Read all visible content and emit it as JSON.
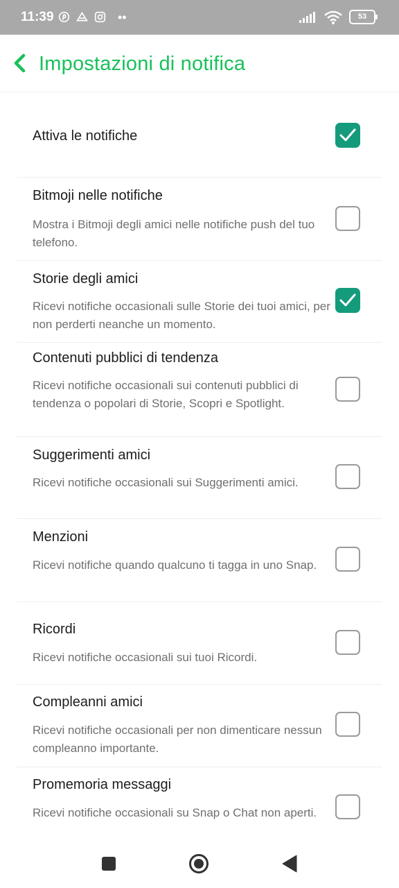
{
  "status_bar": {
    "time": "11:39",
    "battery": "53",
    "icons": [
      "pinterest-icon",
      "drive-icon",
      "instagram-icon",
      "more-dots-icon",
      "signal-icon",
      "wifi-icon",
      "battery-icon"
    ]
  },
  "header": {
    "title": "Impostazioni di notifica",
    "back_icon": "chevron-left-icon",
    "accent_color": "#19c05a"
  },
  "settings": [
    {
      "title": "Attiva le notifiche",
      "description": "",
      "checked": true
    },
    {
      "title": "Bitmoji nelle notifiche",
      "description": "Mostra i Bitmoji degli amici nelle notifiche push del tuo telefono.",
      "checked": false
    },
    {
      "title": "Storie degli amici",
      "description": "Ricevi notifiche occasionali sulle Storie dei tuoi amici, per non perderti neanche un momento.",
      "checked": true
    },
    {
      "title": "Contenuti pubblici di tendenza",
      "description": "Ricevi notifiche occasionali sui contenuti pubblici di tendenza o popolari di Storie, Scopri e Spotlight.",
      "checked": false
    },
    {
      "title": "Suggerimenti amici",
      "description": "Ricevi notifiche occasionali sui Suggerimenti amici.",
      "checked": false
    },
    {
      "title": "Menzioni",
      "description": "Ricevi notifiche quando qualcuno ti tagga in uno Snap.",
      "checked": false
    },
    {
      "title": "Ricordi",
      "description": "Ricevi notifiche occasionali sui tuoi Ricordi.",
      "checked": false
    },
    {
      "title": "Compleanni amici",
      "description": "Ricevi notifiche occasionali per non dimenticare nessun compleanno importante.",
      "checked": false
    },
    {
      "title": "Promemoria messaggi",
      "description": "Ricevi notifiche occasionali su Snap o Chat non aperti.",
      "checked": false
    }
  ],
  "colors": {
    "checkbox_checked": "#149b7c",
    "checkbox_unchecked_border": "#9a9a9a"
  },
  "nav_bar": {
    "icons": [
      "recent-apps-square-icon",
      "home-circle-icon",
      "back-triangle-icon"
    ]
  }
}
